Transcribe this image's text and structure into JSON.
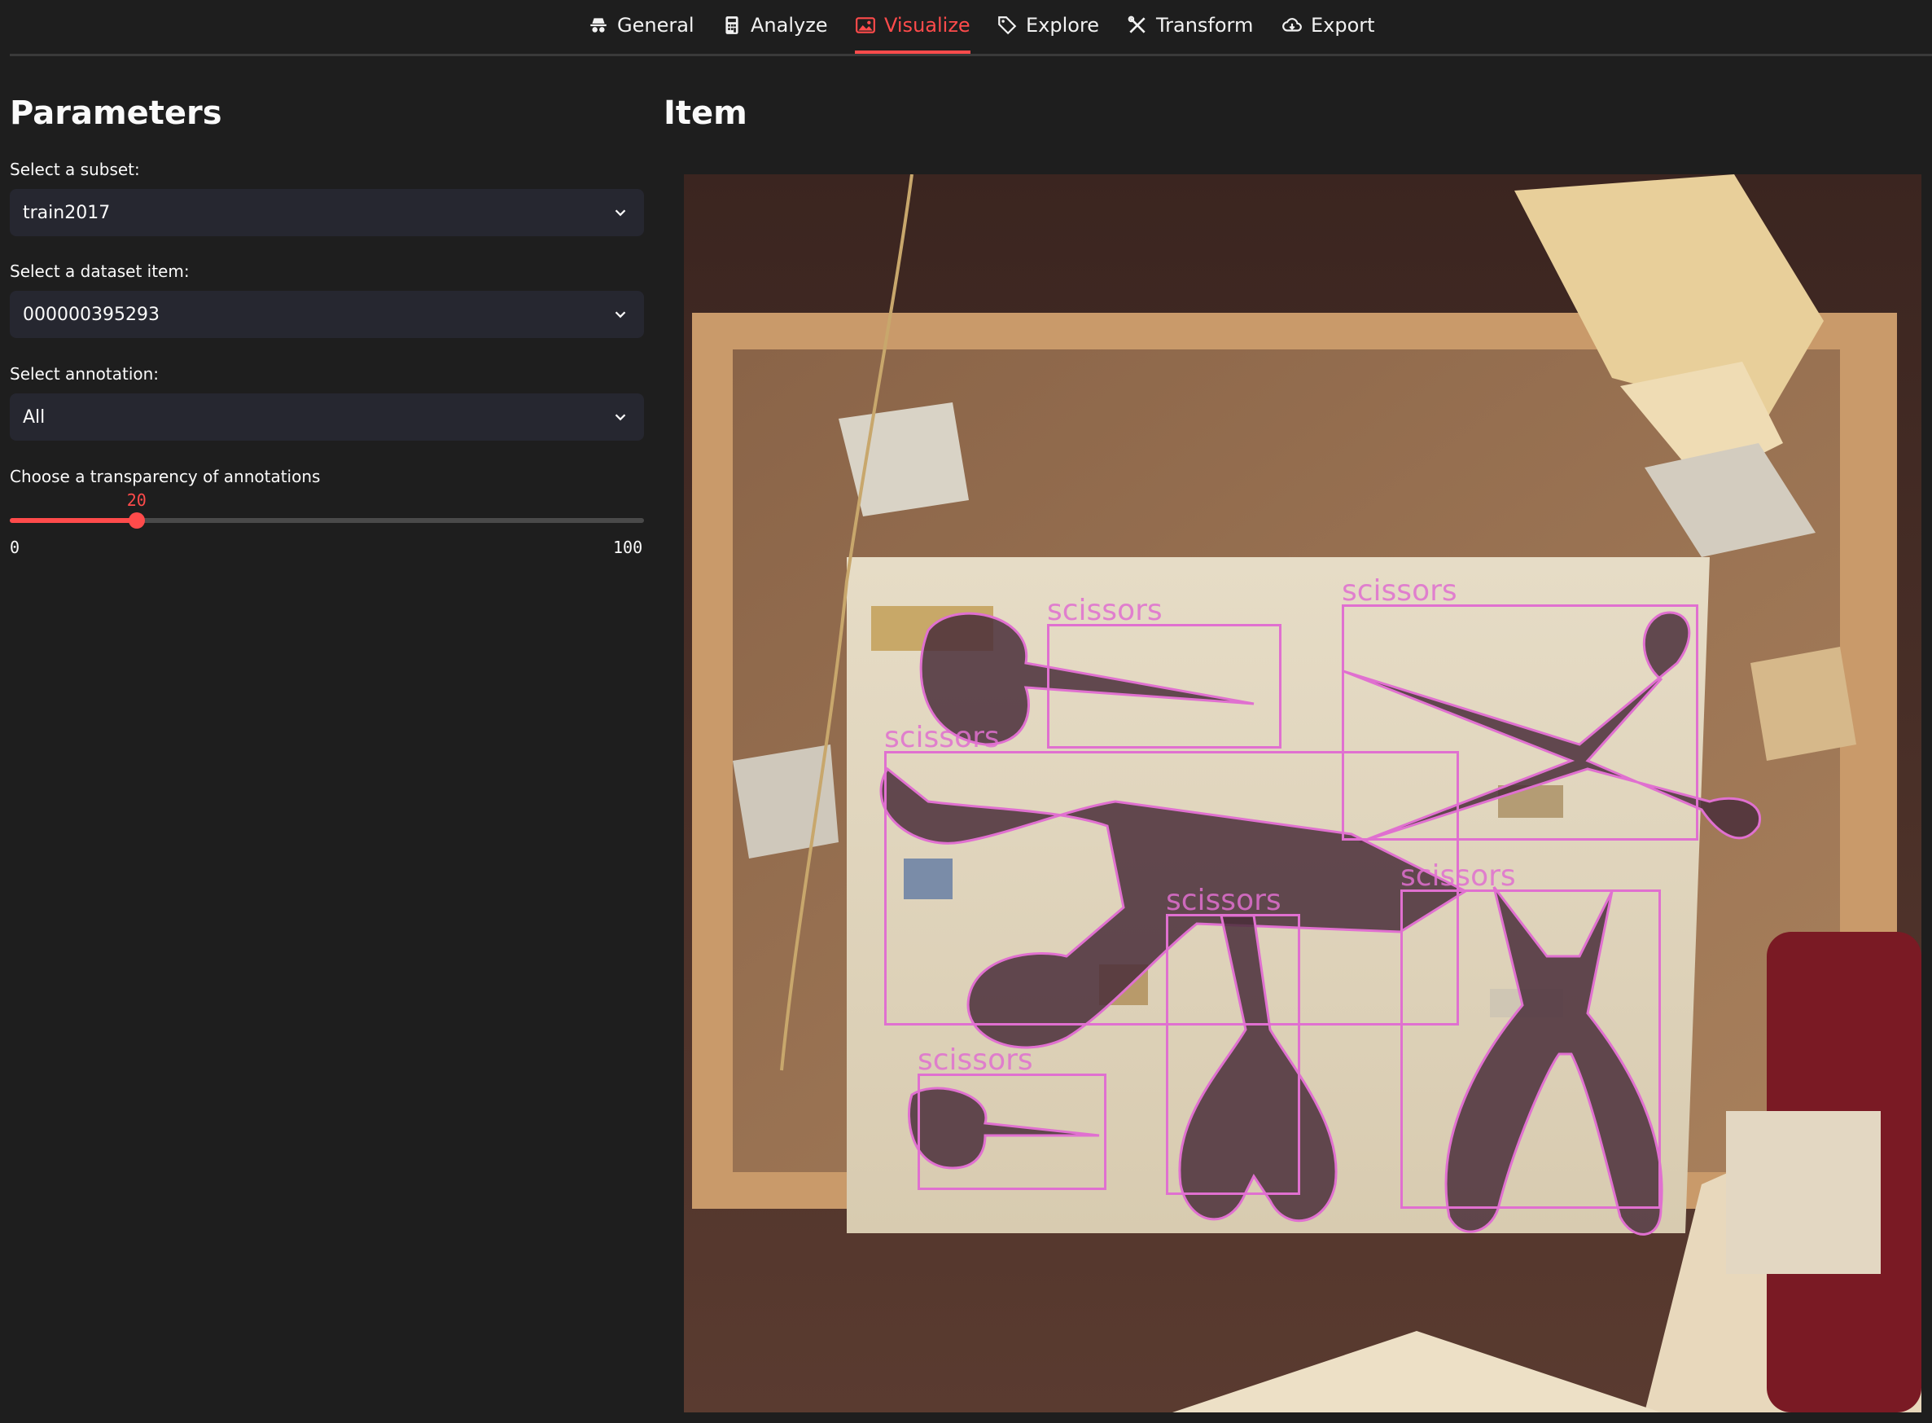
{
  "tabs": [
    {
      "label": "General",
      "icon": "spy-icon",
      "active": false
    },
    {
      "label": "Analyze",
      "icon": "calculator-icon",
      "active": false
    },
    {
      "label": "Visualize",
      "icon": "image-icon",
      "active": true
    },
    {
      "label": "Explore",
      "icon": "tag-icon",
      "active": false
    },
    {
      "label": "Transform",
      "icon": "tools-icon",
      "active": false
    },
    {
      "label": "Export",
      "icon": "cloud-download-icon",
      "active": false
    }
  ],
  "parameters": {
    "title": "Parameters",
    "subset": {
      "label": "Select a subset:",
      "value": "train2017"
    },
    "item": {
      "label": "Select a dataset item:",
      "value": "000000395293"
    },
    "annotation": {
      "label": "Select annotation:",
      "value": "All"
    },
    "transparency": {
      "label": "Choose a transparency of annotations",
      "value": 20,
      "value_text": "20",
      "min": "0",
      "max": "100"
    }
  },
  "item_panel": {
    "title": "Item",
    "annotations": [
      {
        "label": "scissors"
      },
      {
        "label": "scissors"
      },
      {
        "label": "scissors"
      },
      {
        "label": "scissors"
      },
      {
        "label": "scissors"
      },
      {
        "label": "scissors"
      }
    ]
  },
  "colors": {
    "accent": "#ff4b4b",
    "annotation": "#e070d0",
    "background": "#1e1e1e",
    "input_bg": "#262730"
  }
}
